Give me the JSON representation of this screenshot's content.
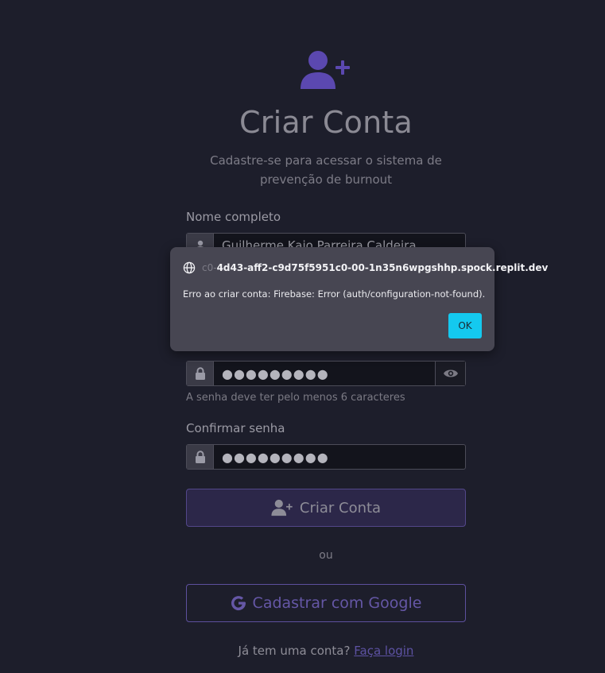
{
  "header": {
    "icon": "user-plus-icon",
    "title": "Criar Conta",
    "subtitle": "Cadastre-se para acessar o sistema de prevenção de burnout"
  },
  "form": {
    "name_label": "Nome completo",
    "name_value": "Guilherme Kaio Parreira Caldeira",
    "password_value": "●●●●●●●●●",
    "password_hint": "A senha deve ter pelo menos 6 caracteres",
    "confirm_label": "Confirmar senha",
    "confirm_value": "●●●●●●●●●",
    "submit_label": "Criar Conta",
    "separator": "ou",
    "google_label": "Cadastrar com Google",
    "login_prompt": "Já tem uma conta?",
    "login_link": "Faça login"
  },
  "dialog": {
    "origin_hidden": "c0-",
    "origin": "4d43-aff2-c9d75f5951c0-00-1n35n6wpgshhp.spock.replit.dev",
    "message": "Erro ao criar conta: Firebase: Error (auth/configuration-not-found).",
    "ok_label": "OK"
  },
  "colors": {
    "background": "#1d1e2b",
    "accent": "#5d52a3",
    "dialog_bg": "#474652",
    "ok_button": "#14c9ef"
  }
}
